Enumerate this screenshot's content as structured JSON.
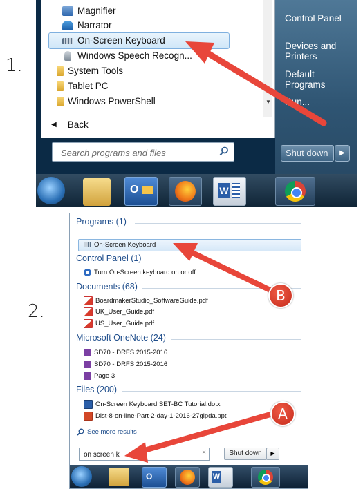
{
  "steps": {
    "one": "1.",
    "two": "2."
  },
  "panel1": {
    "programs": [
      {
        "label": "Magnifier",
        "icon": "magnifier-icon"
      },
      {
        "label": "Narrator",
        "icon": "narrator-icon"
      },
      {
        "label": "On-Screen Keyboard",
        "icon": "keyboard-icon",
        "selected": true
      },
      {
        "label": "Windows Speech Recogn...",
        "icon": "microphone-icon"
      },
      {
        "label": "System Tools",
        "icon": "folder-icon"
      },
      {
        "label": "Tablet PC",
        "icon": "folder-icon"
      },
      {
        "label": "Windows PowerShell",
        "icon": "folder-icon"
      }
    ],
    "back": "Back",
    "search_placeholder": "Search programs and files",
    "right_items": [
      "Control Panel",
      "Devices and Printers",
      "Default Programs",
      "Run..."
    ],
    "shutdown": "Shut down",
    "taskbar": [
      "start-orb",
      "file-explorer-icon",
      "outlook-icon",
      "firefox-icon",
      "word-icon",
      "chrome-icon"
    ]
  },
  "panel2": {
    "sections": [
      {
        "title": "Programs (1)",
        "items": [
          {
            "label": "On-Screen Keyboard",
            "icon": "keyboard-icon"
          }
        ]
      },
      {
        "title": "Control Panel (1)",
        "items": [
          {
            "label": "Turn On-Screen keyboard on or off",
            "icon": "ease-of-access-icon"
          }
        ]
      },
      {
        "title": "Documents (68)",
        "items": [
          {
            "label": "BoardmakerStudio_SoftwareGuide.pdf",
            "icon": "pdf-icon"
          },
          {
            "label": "UK_User_Guide.pdf",
            "icon": "pdf-icon"
          },
          {
            "label": "US_User_Guide.pdf",
            "icon": "pdf-icon"
          }
        ]
      },
      {
        "title": "Microsoft OneNote (24)",
        "items": [
          {
            "label": "SD70 - DRFS 2015-2016",
            "icon": "onenote-icon"
          },
          {
            "label": "SD70 - DRFS 2015-2016",
            "icon": "onenote-icon"
          },
          {
            "label": "Page 3",
            "icon": "onenote-icon"
          }
        ]
      },
      {
        "title": "Files (200)",
        "items": [
          {
            "label": "On-Screen Keyboard SET-BC Tutorial.dotx",
            "icon": "word-doc-icon"
          },
          {
            "label": "Dist-8-on-line-Part-2-day-1-2016-27gipda.ppt",
            "icon": "ppt-icon"
          }
        ]
      }
    ],
    "see_more": "See more results",
    "search_value": "on screen k",
    "shutdown": "Shut down",
    "callout_a": "A",
    "callout_b": "B"
  },
  "colors": {
    "arrow": "#e8463a",
    "section_title": "#1f4e8c",
    "highlight": "#cfe6f8"
  }
}
